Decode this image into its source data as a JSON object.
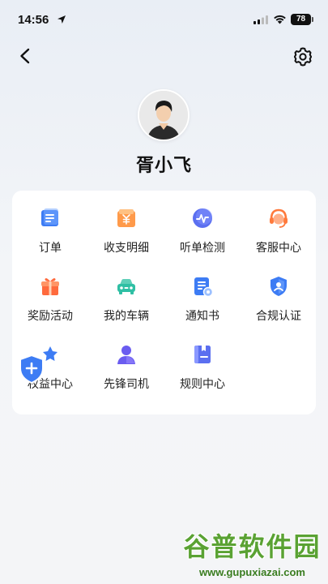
{
  "status_bar": {
    "time": "14:56",
    "battery": "78"
  },
  "profile": {
    "name": "胥小飞"
  },
  "menu": {
    "items": [
      {
        "label": "订单",
        "icon": "order-icon"
      },
      {
        "label": "收支明细",
        "icon": "income-expense-icon"
      },
      {
        "label": "听单检测",
        "icon": "order-listening-check-icon"
      },
      {
        "label": "客服中心",
        "icon": "customer-service-icon"
      },
      {
        "label": "奖励活动",
        "icon": "gift-icon"
      },
      {
        "label": "我的车辆",
        "icon": "car-icon"
      },
      {
        "label": "通知书",
        "icon": "notice-icon"
      },
      {
        "label": "合规认证",
        "icon": "compliance-shield-icon"
      },
      {
        "label": "权益中心",
        "icon": "benefits-icon"
      },
      {
        "label": "先锋司机",
        "icon": "pioneer-driver-icon"
      },
      {
        "label": "规则中心",
        "icon": "rules-book-icon"
      }
    ]
  },
  "watermark": {
    "title": "谷普软件园",
    "url": "www.gupuxiazai.com"
  },
  "colors": {
    "background": "#eef2f7",
    "card": "#ffffff",
    "accent_blue": "#3d7cf4",
    "accent_orange": "#ff7a3c"
  }
}
